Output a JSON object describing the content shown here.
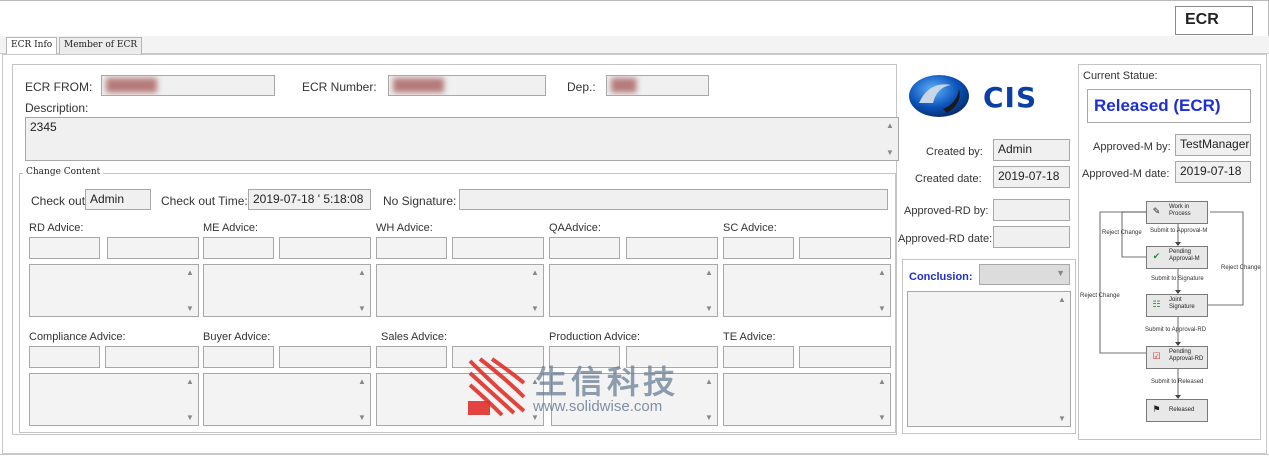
{
  "header": {
    "title": "ECR"
  },
  "tabs": [
    {
      "label": "ECR Info",
      "active": true
    },
    {
      "label": "Member of ECR",
      "active": false
    }
  ],
  "form": {
    "ecr_from_label": "ECR FROM:",
    "ecr_number_label": "ECR Number:",
    "dep_label": "Dep.:",
    "description_label": "Description:",
    "description_value": "2345"
  },
  "change_content": {
    "legend": "Change Content",
    "check_out_label": "Check out:",
    "check_out_value": "Admin",
    "check_out_time_label": "Check out Time:",
    "check_out_time_value": "2019-07-18 ' 5:18:08",
    "no_signature_label": "No Signature:",
    "advice_row1": [
      "RD Advice:",
      "ME Advice:",
      "WH Advice:",
      "QAAdvice:",
      "SC  Advice:"
    ],
    "advice_row2": [
      "Compliance Advice:",
      "Buyer Advice:",
      "Sales  Advice:",
      "Production Advice:",
      "TE Advice:"
    ]
  },
  "brand": {
    "logo_text": "CIS"
  },
  "info": {
    "created_by_label": "Created by:",
    "created_by_value": "Admin",
    "created_date_label": "Created date:",
    "created_date_value": "2019-07-18",
    "approved_rd_by_label": "Approved-RD by:",
    "approved_rd_date_label": "Approved-RD date:",
    "conclusion_label": "Conclusion:"
  },
  "status": {
    "current_label": "Current Statue:",
    "value": "Released (ECR)",
    "approved_m_by_label": "Approved-M by:",
    "approved_m_by_value": "TestManager",
    "approved_m_date_label": "Approved-M date:",
    "approved_m_date_value": "2019-07-18"
  },
  "workflow": {
    "nodes": [
      "Work in Process",
      "Pending Approval-M",
      "Joint Signature",
      "Pending Approval-RD",
      "Released"
    ],
    "edges": [
      "Submit to Approval-M",
      "Submit to Signature",
      "Submit to Approval-RD",
      "Submit to Released"
    ],
    "reject_labels": [
      "Reject Change",
      "Reject Change",
      "Reject Change"
    ]
  },
  "watermark": {
    "text": "生信科技",
    "url": "www.solidwise.com"
  },
  "colors": {
    "accent_blue": "#1c2fd4",
    "watermark_red": "#e0302a"
  }
}
